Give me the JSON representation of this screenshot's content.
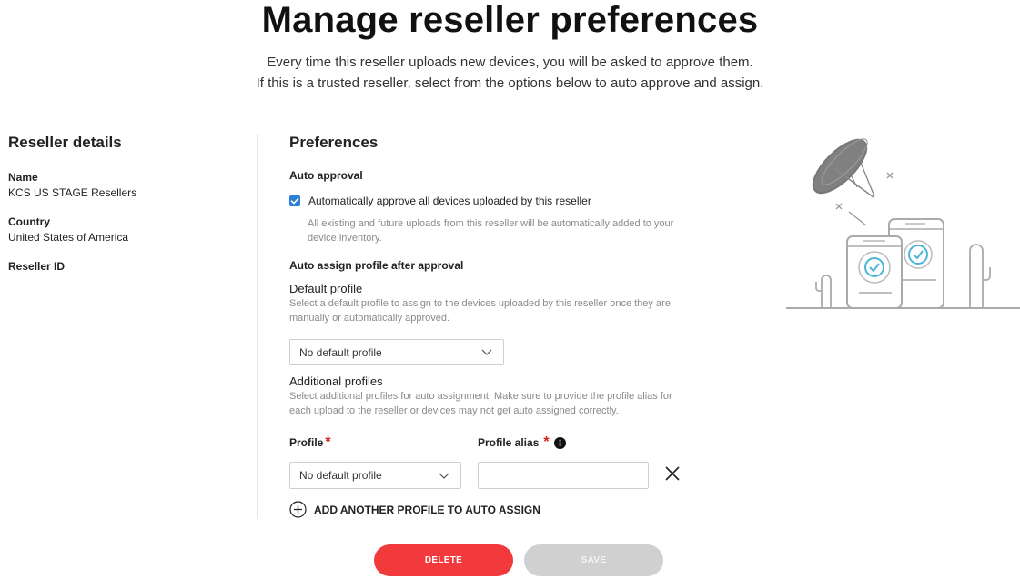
{
  "header": {
    "title": "Manage reseller preferences",
    "subtitle_line1": "Every time this reseller uploads new devices, you will be asked to approve them.",
    "subtitle_line2": "If this is a trusted reseller, select from the options below to auto approve and assign."
  },
  "reseller": {
    "section_title": "Reseller details",
    "name_label": "Name",
    "name_value": "KCS US STAGE Resellers",
    "country_label": "Country",
    "country_value": "United States of America",
    "id_label": "Reseller ID"
  },
  "preferences": {
    "section_title": "Preferences",
    "auto_approval_label": "Auto approval",
    "auto_approve_checkbox_label": "Automatically approve all devices uploaded by this reseller",
    "auto_approve_checked": true,
    "auto_approve_hint_line1": "All existing and future uploads from this reseller will be automatically added to your",
    "auto_approve_hint_line2": "device inventory.",
    "auto_assign_label": "Auto assign profile after approval",
    "default_profile_label": "Default profile",
    "default_profile_hint_line1": "Select a default profile to assign to the devices uploaded by this reseller once they are",
    "default_profile_hint_line2": "manually or automatically approved.",
    "default_profile_value": "No default profile",
    "additional_profiles_label": "Additional profiles",
    "additional_profiles_hint_line1": "Select additional profiles for auto assignment. Make sure to provide the profile alias for",
    "additional_profiles_hint_line2": "each upload to the reseller or devices may not get auto assigned correctly.",
    "profile_column_label": "Profile",
    "profile_alias_column_label": "Profile alias",
    "required_mark": "*",
    "profile_value": "No default profile",
    "profile_alias_value": "",
    "add_profile_label": "ADD ANOTHER PROFILE TO AUTO ASSIGN"
  },
  "actions": {
    "delete_label": "DELETE",
    "save_label": "SAVE"
  },
  "colors": {
    "accent_blue": "#2a7fd6",
    "delete_red": "#f23a3c",
    "save_disabled": "#d0d0d0",
    "required_red": "#d32020"
  },
  "icons": {
    "checkbox": "check-icon",
    "dropdown": "chevron-down-icon",
    "info": "info-icon",
    "remove": "close-icon",
    "add": "plus-circle-icon"
  }
}
